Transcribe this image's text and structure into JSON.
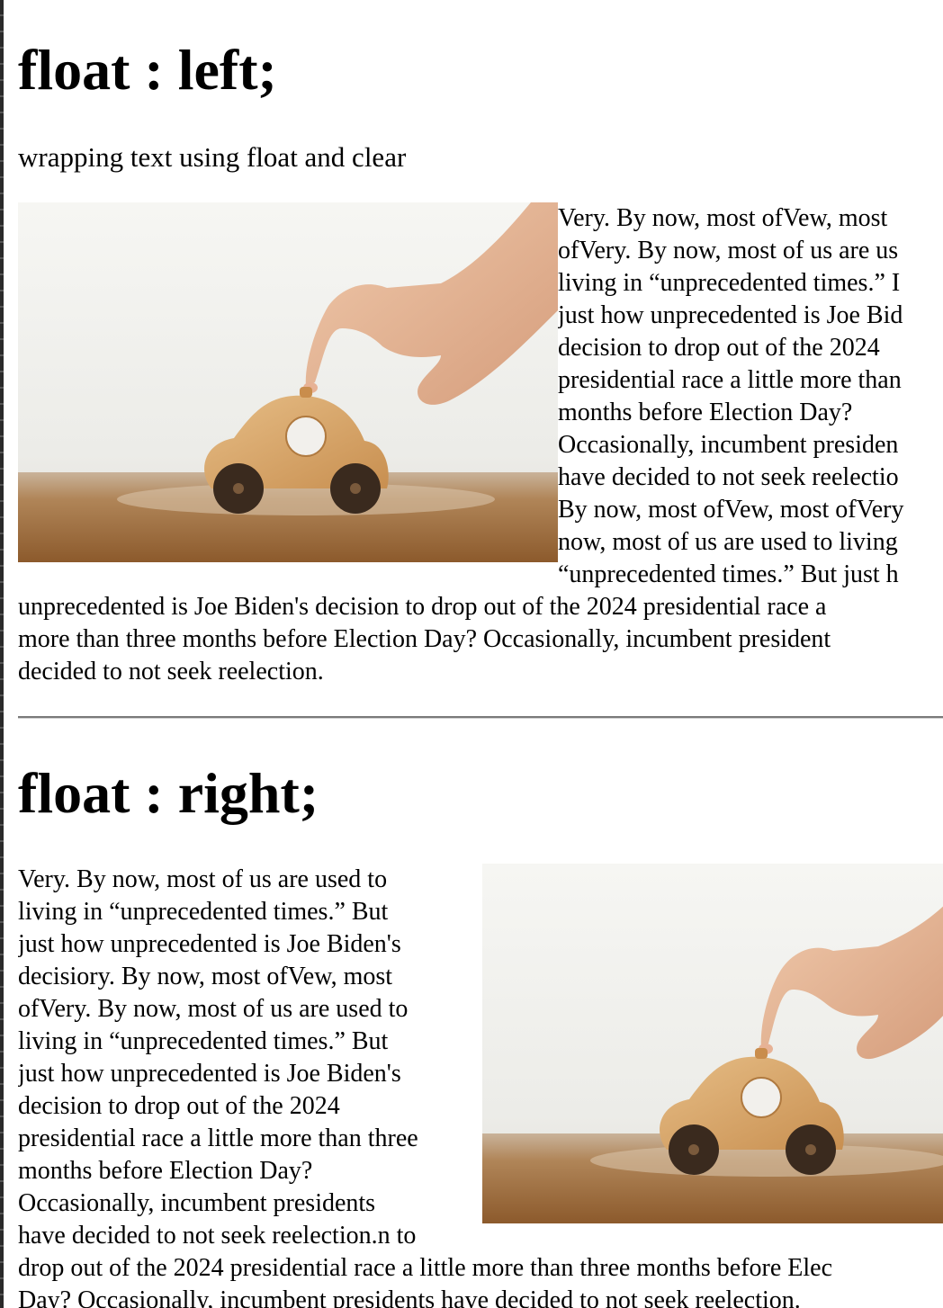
{
  "section_left": {
    "heading": "float : left;",
    "subtitle": "wrapping text using float and clear",
    "image_alt": "wooden toy car pressed by a finger",
    "text_lines_beside": [
      "Very. By now, most ofVew, most",
      "ofVery. By now, most of us are us",
      "living in “unprecedented times.” I",
      "just how unprecedented is Joe Bid",
      "decision to drop out of the 2024",
      "presidential race a little more than",
      "months before Election Day?",
      "Occasionally, incumbent presiden",
      "have decided to not seek reelectio",
      "By now, most ofVew, most ofVery",
      "now, most of us are used to living",
      "“unprecedented times.” But just h"
    ],
    "text_lines_below": [
      "unprecedented is Joe Biden's decision to drop out of the 2024 presidential race a",
      "more than three months before Election Day? Occasionally, incumbent president",
      "decided to not seek reelection."
    ]
  },
  "section_right": {
    "heading": "float : right;",
    "image_alt": "wooden toy car pressed by a finger",
    "text_lines_beside": [
      "Very. By now, most of us are used to",
      "living in “unprecedented times.” But",
      "just how unprecedented is Joe Biden's",
      "decisiory. By now, most ofVew, most",
      "ofVery. By now, most of us are used to",
      "living in “unprecedented times.” But",
      "just how unprecedented is Joe Biden's",
      "decision to drop out of the 2024",
      "presidential race a little more than three",
      "months before Election Day?",
      "Occasionally, incumbent presidents",
      "have decided to not seek reelection.n to"
    ],
    "text_lines_below": [
      "drop out of the 2024 presidential race a little more than three months before Elec",
      "Day? Occasionally, incumbent presidents have decided to not seek reelection."
    ]
  },
  "colors": {
    "background": "#ffffff",
    "text": "#000000",
    "rule": "#7a7a7a",
    "wood": "#d9a66a",
    "wheel": "#3a2a1e",
    "table": "#a0682f"
  }
}
